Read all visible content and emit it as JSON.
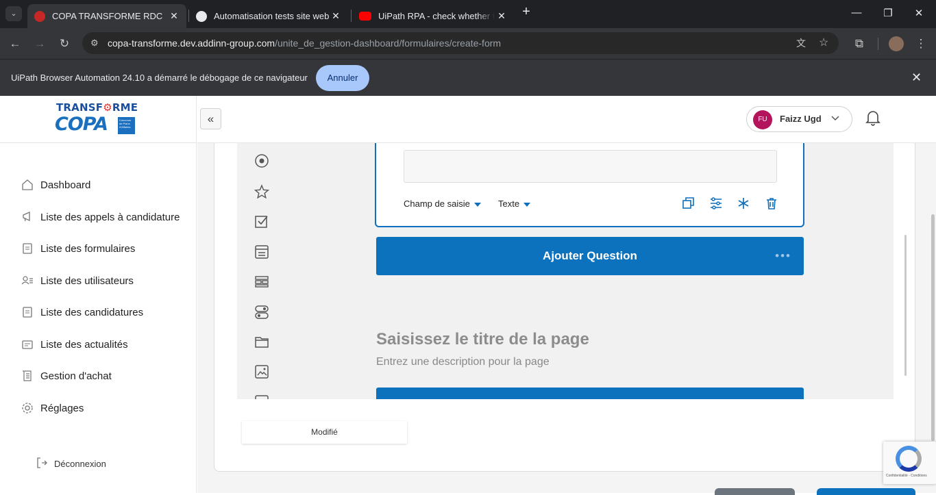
{
  "browser": {
    "tabs": [
      {
        "title": "COPA TRANSFORME RDC",
        "active": true
      },
      {
        "title": "Automatisation tests site web",
        "active": false
      },
      {
        "title": "UiPath RPA - check whether the",
        "active": false
      }
    ],
    "new_tab": "+",
    "address": {
      "domain": "copa-transforme.dev.addinn-group.com",
      "path": "/unite_de_gestion-dashboard/formulaires/create-form"
    },
    "notice": {
      "message": "UiPath Browser Automation 24.10 a démarré le débogage de ce navigateur",
      "cancel_label": "Annuler"
    }
  },
  "logo": {
    "top": "TRANSF",
    "gear": "⚙",
    "top2": "RME",
    "bottom": "COPA",
    "box_text": "Concours de Plans d'Affaires"
  },
  "sidebar": {
    "items": [
      {
        "label": "Dashboard",
        "icon": "home-icon"
      },
      {
        "label": "Liste des appels à candidature",
        "icon": "megaphone-icon"
      },
      {
        "label": "Liste des formulaires",
        "icon": "form-icon"
      },
      {
        "label": "Liste des utilisateurs",
        "icon": "users-icon"
      },
      {
        "label": "Liste des candidatures",
        "icon": "document-icon"
      },
      {
        "label": "Liste des actualités",
        "icon": "news-icon"
      },
      {
        "label": "Gestion d'achat",
        "icon": "receipt-icon"
      },
      {
        "label": "Réglages",
        "icon": "settings-icon"
      }
    ],
    "logout_label": "Déconnexion"
  },
  "header": {
    "user_initials": "FU",
    "user_name": "Faizz Ugd"
  },
  "editor": {
    "question": {
      "field_type": "Champ de saisie",
      "input_type": "Texte"
    },
    "add_question_label": "Ajouter Question",
    "page_title_placeholder": "Saisissez le titre de la page",
    "page_desc_placeholder": "Entrez une description pour la page",
    "modified_label": "Modifié"
  },
  "recaptcha": {
    "text": "Confidentialité - Conditions"
  },
  "colors": {
    "accent": "#0d72bd",
    "avatar": "#b3145b"
  }
}
